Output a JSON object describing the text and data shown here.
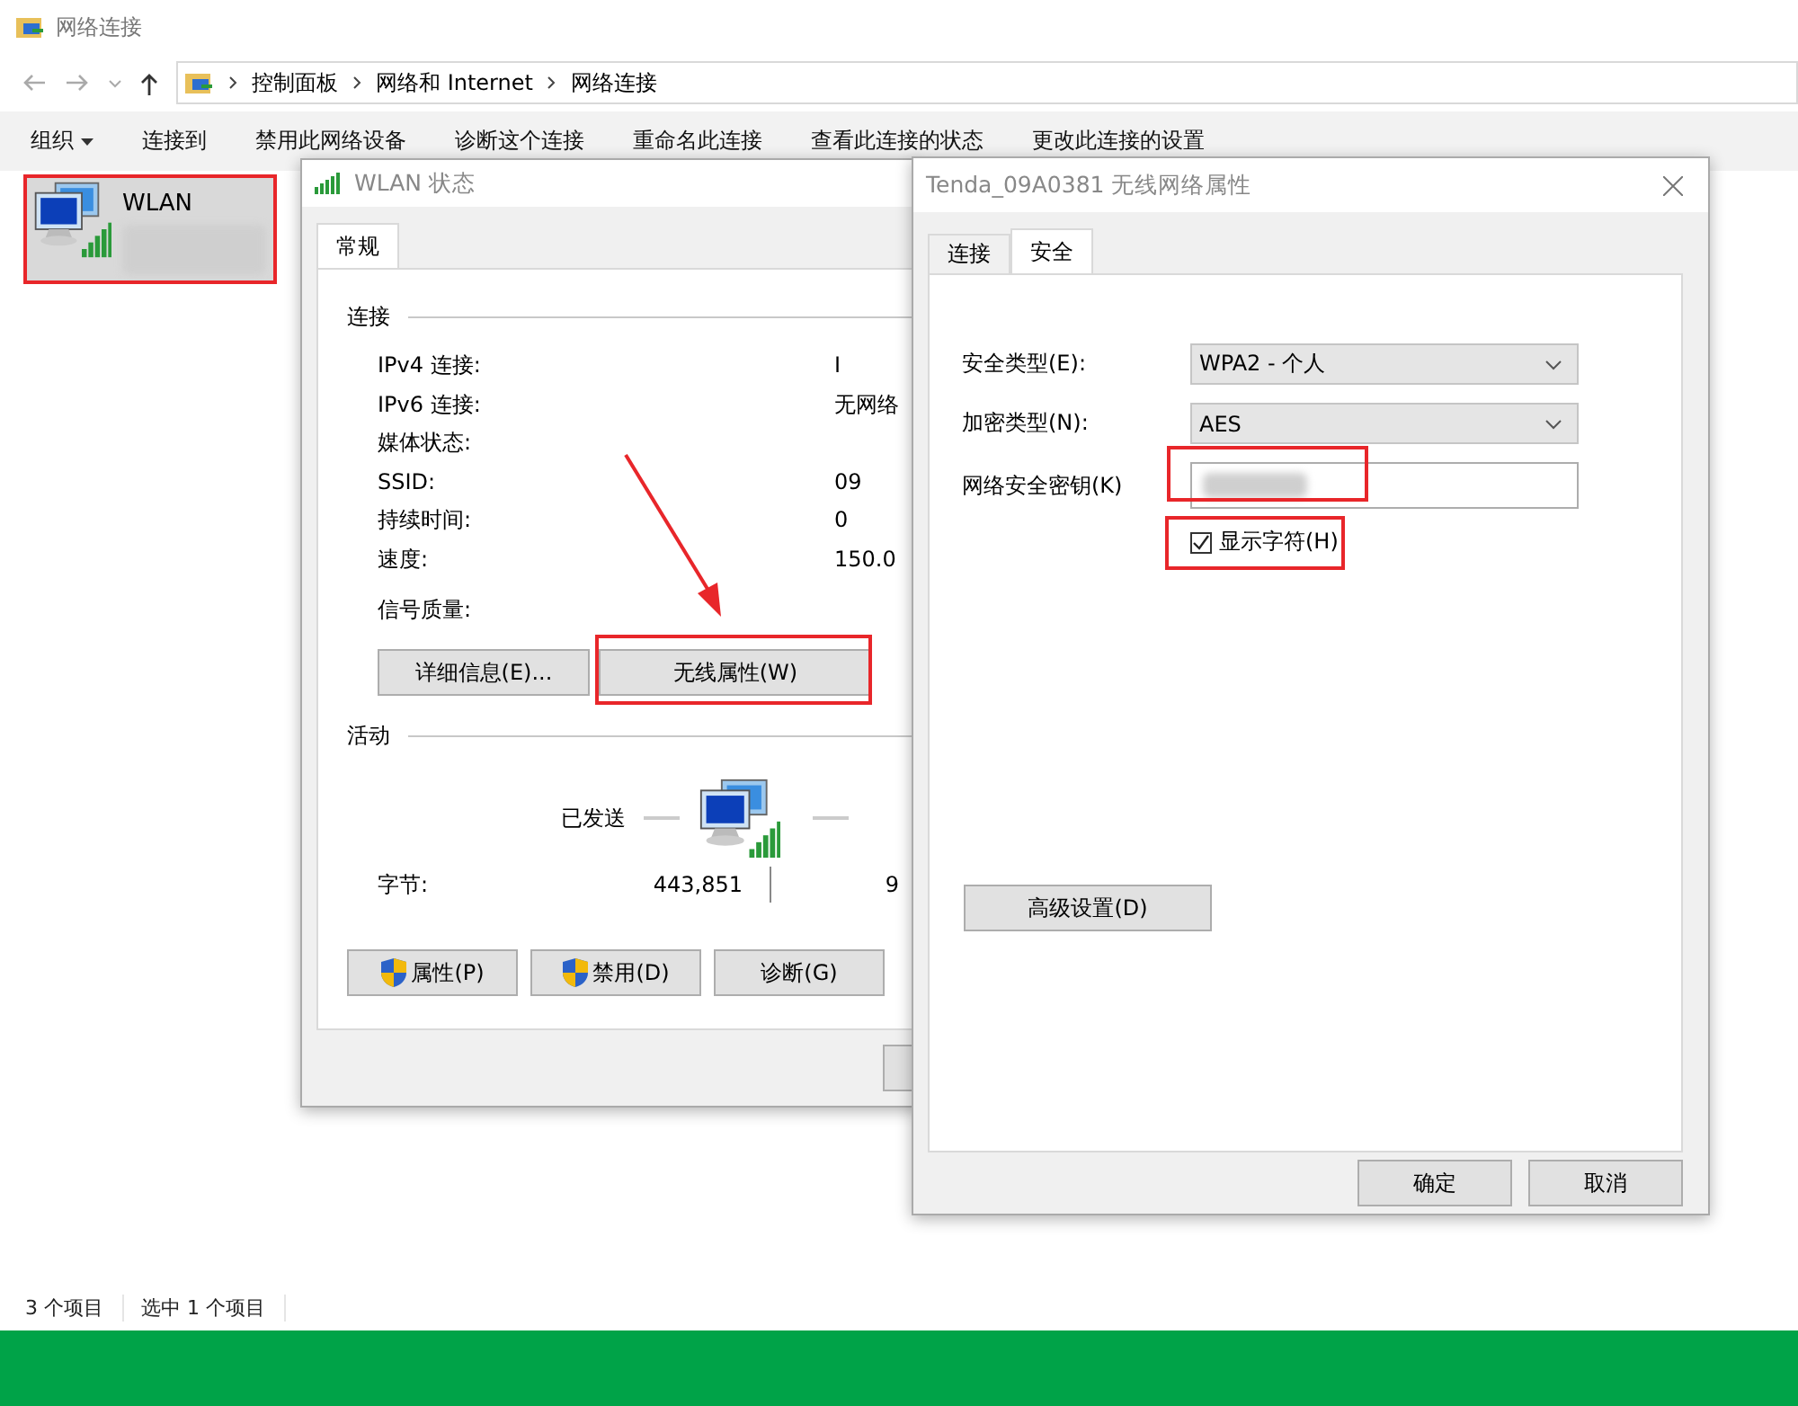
{
  "explorer": {
    "title": "网络连接",
    "breadcrumb": [
      "控制面板",
      "网络和 Internet",
      "网络连接"
    ],
    "commands": [
      {
        "label": "组织",
        "kind": "menu"
      },
      {
        "label": "连接到",
        "kind": "plain"
      },
      {
        "label": "禁用此网络设备",
        "kind": "plain"
      },
      {
        "label": "诊断这个连接",
        "kind": "plain"
      },
      {
        "label": "重命名此连接",
        "kind": "plain"
      },
      {
        "label": "查看此连接的状态",
        "kind": "plain"
      },
      {
        "label": "更改此连接的设置",
        "kind": "plain"
      }
    ],
    "items": [
      {
        "name": "WLAN",
        "selected": true
      }
    ],
    "status_bar": [
      "3 个项目",
      "选中 1 个项目"
    ]
  },
  "wlan_status": {
    "title": "WLAN 状态",
    "tabs": [
      {
        "label": "常规",
        "selected": true
      }
    ],
    "connection": {
      "label": "连接",
      "rows": [
        {
          "label": "IPv4 连接:",
          "value": "I"
        },
        {
          "label": "IPv6 连接:",
          "value": "无网络"
        },
        {
          "label": "媒体状态:",
          "value": ""
        },
        {
          "label": "SSID:",
          "value": "09"
        },
        {
          "label": "持续时间:",
          "value": "0"
        },
        {
          "label": "速度:",
          "value": "150.0"
        }
      ],
      "signal_label": "信号质量:"
    },
    "buttons": [
      "详细信息(E)...",
      "无线属性(W)"
    ],
    "activity": {
      "label": "活动",
      "sent_label": "已发送",
      "bytes_label": "字节:",
      "bytes_sent": "443,851",
      "bytes_received": "9"
    },
    "bottom_buttons": [
      {
        "label": "属性(P)",
        "kind": "admin"
      },
      {
        "label": "禁用(D)",
        "kind": "admin"
      },
      {
        "label": "诊断(G)",
        "kind": "plain"
      }
    ]
  },
  "wireless_properties": {
    "title": "Tenda_09A0381 无线网络属性",
    "tabs": [
      {
        "label": "连接",
        "selected": false
      },
      {
        "label": "安全",
        "selected": true
      }
    ],
    "dropdowns": [
      {
        "label": "安全类型(E):",
        "value": "WPA2 - 个人"
      },
      {
        "label": "加密类型(N):",
        "value": "AES"
      }
    ],
    "key_label": "网络安全密钥(K)",
    "show_characters": {
      "label": "显示字符(H)",
      "checked": true
    },
    "advanced_button": "高级设置(D)",
    "buttons": [
      "确定",
      "取消"
    ]
  }
}
